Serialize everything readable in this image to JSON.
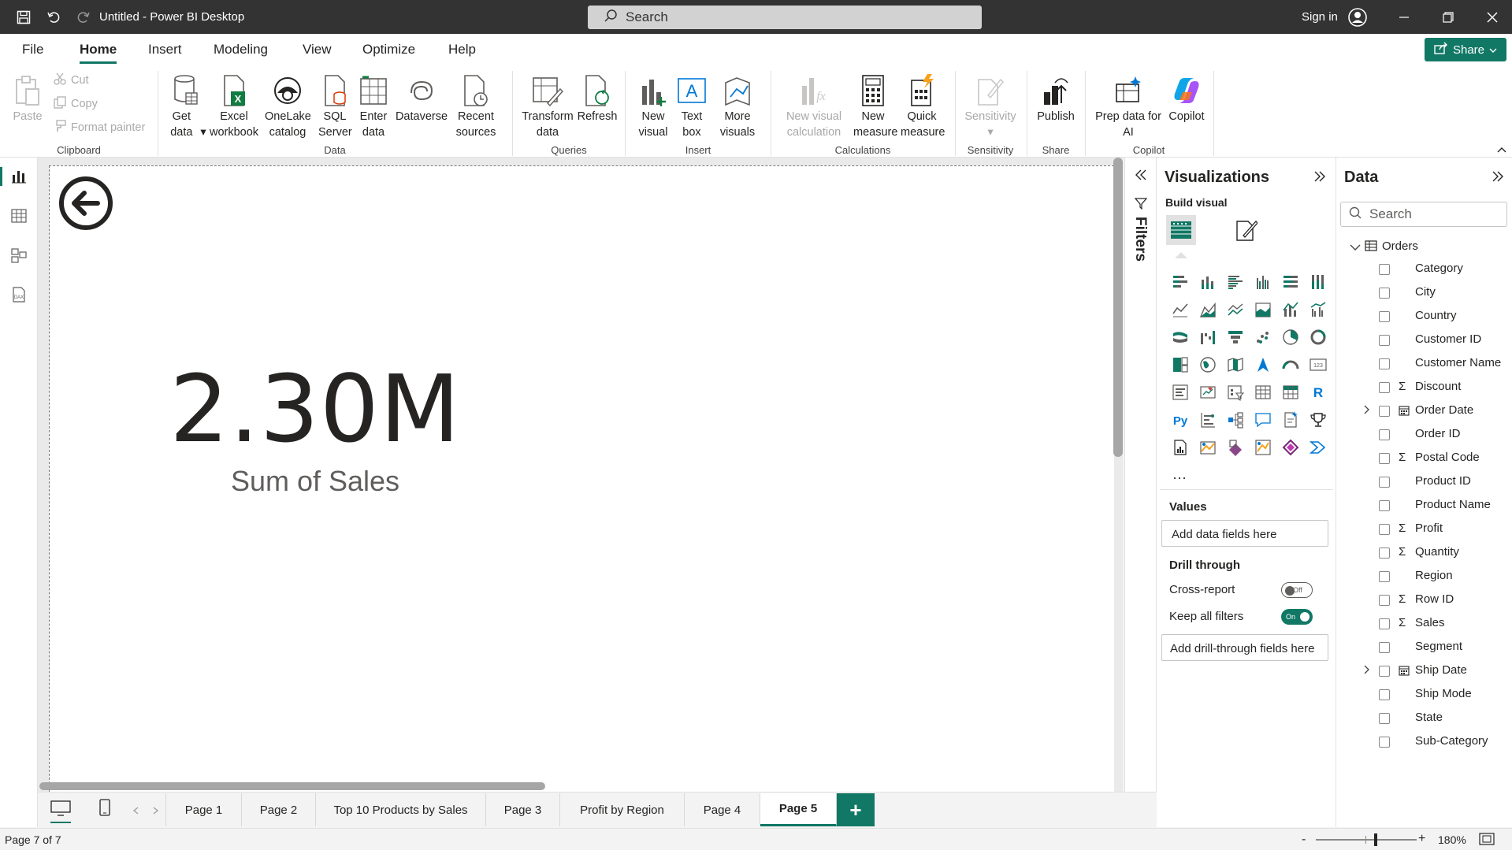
{
  "window": {
    "title": "Untitled - Power BI Desktop",
    "search_placeholder": "Search",
    "sign_in": "Sign in"
  },
  "menu": {
    "items": [
      "File",
      "Home",
      "Insert",
      "Modeling",
      "View",
      "Optimize",
      "Help"
    ],
    "active": "Home",
    "share_label": "Share"
  },
  "ribbon": {
    "clipboard": {
      "paste": "Paste",
      "cut": "Cut",
      "copy": "Copy",
      "format_painter": "Format painter",
      "group": "Clipboard"
    },
    "data": {
      "get_data": "Get data",
      "excel": "Excel workbook",
      "onelake": "OneLake catalog",
      "sql": "SQL Server",
      "enter_data": "Enter data",
      "dataverse": "Dataverse",
      "recent": "Recent sources",
      "group": "Data"
    },
    "queries": {
      "transform": "Transform data",
      "refresh": "Refresh",
      "group": "Queries"
    },
    "insert": {
      "new_visual": "New visual",
      "text_box": "Text box",
      "more_visuals": "More visuals",
      "group": "Insert"
    },
    "calculations": {
      "new_visual_calc": "New visual calculation",
      "new_measure": "New measure",
      "quick_measure": "Quick measure",
      "group": "Calculations"
    },
    "sensitivity": {
      "label": "Sensitivity",
      "group": "Sensitivity"
    },
    "share": {
      "publish": "Publish",
      "group": "Share"
    },
    "copilot": {
      "prep_data": "Prep data for AI",
      "copilot": "Copilot",
      "group": "Copilot"
    }
  },
  "canvas": {
    "kpi_value": "2.30M",
    "kpi_label": "Sum of Sales"
  },
  "filters": {
    "label": "Filters"
  },
  "visualizations": {
    "title": "Visualizations",
    "build_visual": "Build visual",
    "more": "...",
    "values_label": "Values",
    "values_placeholder": "Add data fields here",
    "drill_through": "Drill through",
    "cross_report": "Cross-report",
    "cross_report_state": "Off",
    "keep_all_filters": "Keep all filters",
    "keep_all_filters_state": "On",
    "drill_placeholder": "Add drill-through fields here"
  },
  "data_pane": {
    "title": "Data",
    "search_placeholder": "Search",
    "table": "Orders",
    "fields": [
      {
        "name": "Category",
        "sigma": false,
        "expand": false
      },
      {
        "name": "City",
        "sigma": false,
        "expand": false
      },
      {
        "name": "Country",
        "sigma": false,
        "expand": false
      },
      {
        "name": "Customer ID",
        "sigma": false,
        "expand": false
      },
      {
        "name": "Customer Name",
        "sigma": false,
        "expand": false
      },
      {
        "name": "Discount",
        "sigma": true,
        "expand": false
      },
      {
        "name": "Order Date",
        "sigma": false,
        "expand": true
      },
      {
        "name": "Order ID",
        "sigma": false,
        "expand": false
      },
      {
        "name": "Postal Code",
        "sigma": true,
        "expand": false
      },
      {
        "name": "Product ID",
        "sigma": false,
        "expand": false
      },
      {
        "name": "Product Name",
        "sigma": false,
        "expand": false
      },
      {
        "name": "Profit",
        "sigma": true,
        "expand": false
      },
      {
        "name": "Quantity",
        "sigma": true,
        "expand": false
      },
      {
        "name": "Region",
        "sigma": false,
        "expand": false
      },
      {
        "name": "Row ID",
        "sigma": true,
        "expand": false
      },
      {
        "name": "Sales",
        "sigma": true,
        "expand": false
      },
      {
        "name": "Segment",
        "sigma": false,
        "expand": false
      },
      {
        "name": "Ship Date",
        "sigma": false,
        "expand": true
      },
      {
        "name": "Ship Mode",
        "sigma": false,
        "expand": false
      },
      {
        "name": "State",
        "sigma": false,
        "expand": false
      },
      {
        "name": "Sub-Category",
        "sigma": false,
        "expand": false
      }
    ]
  },
  "pages": {
    "tabs": [
      "Page 1",
      "Page 2",
      "Top 10 Products by Sales",
      "Page 3",
      "Profit by Region",
      "Page 4",
      "Page 5"
    ],
    "active": "Page 5",
    "add_label": "+"
  },
  "status": {
    "page_info": "Page 7 of 7",
    "zoom": "180%"
  },
  "colors": {
    "accent": "#117865",
    "titlebar": "#333333"
  }
}
